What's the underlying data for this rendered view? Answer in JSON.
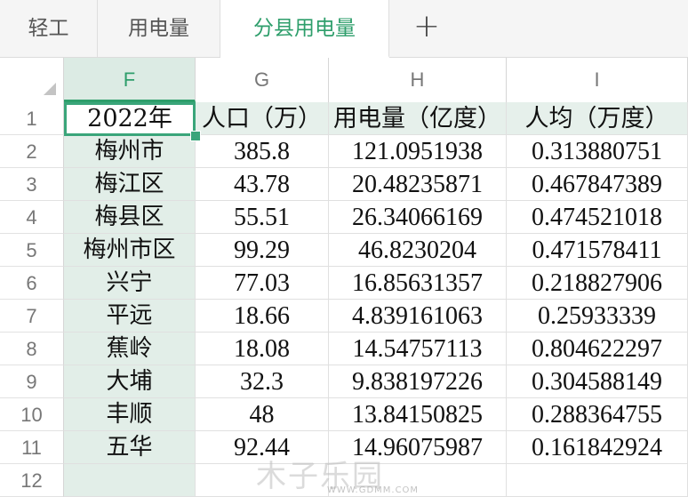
{
  "tabs": [
    {
      "label": "轻工",
      "active": false
    },
    {
      "label": "用电量",
      "active": false
    },
    {
      "label": "分县用电量",
      "active": true
    }
  ],
  "add_tab_label": "+",
  "columns": [
    "F",
    "G",
    "H",
    "I"
  ],
  "selected_column": "F",
  "selected_cell": "F1",
  "rows": [
    {
      "num": "1",
      "cells": [
        "2022年",
        "人口（万）",
        "用电量（亿度）",
        "人均（万度）"
      ]
    },
    {
      "num": "2",
      "cells": [
        "梅州市",
        "385.8",
        "121.0951938",
        "0.313880751"
      ]
    },
    {
      "num": "3",
      "cells": [
        "梅江区",
        "43.78",
        "20.48235871",
        "0.467847389"
      ]
    },
    {
      "num": "4",
      "cells": [
        "梅县区",
        "55.51",
        "26.34066169",
        "0.474521018"
      ]
    },
    {
      "num": "5",
      "cells": [
        "梅州市区",
        "99.29",
        "46.8230204",
        "0.471578411"
      ]
    },
    {
      "num": "6",
      "cells": [
        "兴宁",
        "77.03",
        "16.85631357",
        "0.218827906"
      ]
    },
    {
      "num": "7",
      "cells": [
        "平远",
        "18.66",
        "4.839161063",
        "0.25933339"
      ]
    },
    {
      "num": "8",
      "cells": [
        "蕉岭",
        "18.08",
        "14.54757113",
        "0.804622297"
      ]
    },
    {
      "num": "9",
      "cells": [
        "大埔",
        "32.3",
        "9.838197226",
        "0.304588149"
      ]
    },
    {
      "num": "10",
      "cells": [
        "丰顺",
        "48",
        "13.84150825",
        "0.288364755"
      ]
    },
    {
      "num": "11",
      "cells": [
        "五华",
        "92.44",
        "14.96075987",
        "0.161842924"
      ]
    },
    {
      "num": "12",
      "cells": [
        "",
        "",
        "",
        ""
      ]
    }
  ],
  "watermark": {
    "text": "木子乐园",
    "url": "WWW.GDMM.COM"
  },
  "colors": {
    "accent": "#2e9e6b",
    "selected_column_fill": "#e2eee8"
  }
}
